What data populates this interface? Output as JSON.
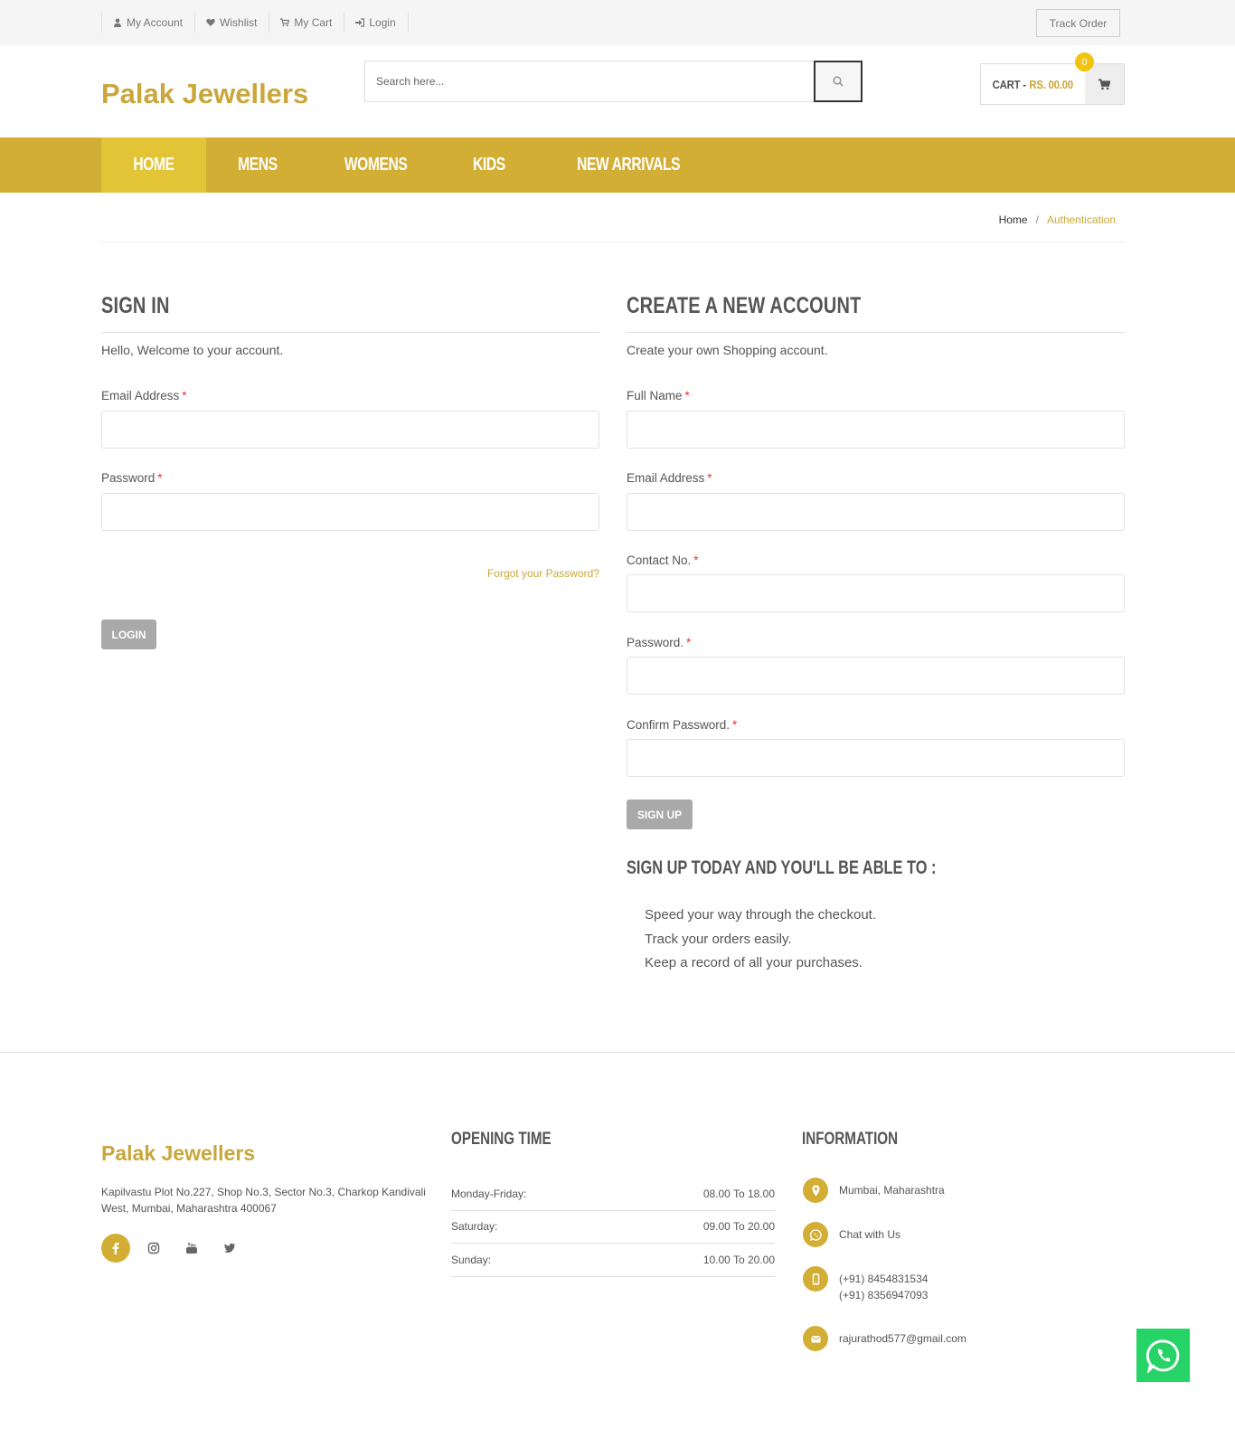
{
  "topbar": {
    "links": [
      {
        "label": "My Account",
        "icon": "user-icon"
      },
      {
        "label": "Wishlist",
        "icon": "heart-icon"
      },
      {
        "label": "My Cart",
        "icon": "cart-icon"
      },
      {
        "label": "Login",
        "icon": "sign-in-icon"
      }
    ],
    "track_order": "Track Order"
  },
  "header": {
    "logo": "Palak Jewellers",
    "search_placeholder": "Search here...",
    "cart_label": "CART -",
    "cart_amount": "RS. 00.00",
    "cart_count": "0"
  },
  "nav": {
    "items": [
      "HOME",
      "MENS",
      "WOMENS",
      "KIDS",
      "NEW ARRIVALS"
    ],
    "active": "HOME"
  },
  "breadcrumb": {
    "home": "Home",
    "separator": "/",
    "current": "Authentication"
  },
  "signin": {
    "title": "SIGN IN",
    "intro": "Hello, Welcome to your account.",
    "email_label": "Email Address",
    "password_label": "Password",
    "required_mark": "*",
    "forgot": "Forgot your Password?",
    "login_button": "LOGIN"
  },
  "signup": {
    "title": "CREATE A NEW ACCOUNT",
    "intro": "Create your own Shopping account.",
    "fullname_label": "Full Name",
    "email_label": "Email Address",
    "contact_label": "Contact No.",
    "password_label": "Password.",
    "confirm_label": "Confirm Password.",
    "signup_button": "SIGN UP",
    "benefits_title": "SIGN UP TODAY AND YOU'LL BE ABLE TO :",
    "benefits": [
      "Speed your way through the checkout.",
      "Track your orders easily.",
      "Keep a record of all your purchases."
    ]
  },
  "footer": {
    "logo": "Palak Jewellers",
    "address": "Kapilvastu Plot No.227, Shop No.3, Sector No.3, Charkop Kandivali West, Mumbai, Maharashtra 400067",
    "socials": [
      "facebook-icon",
      "instagram-icon",
      "youtube-icon",
      "twitter-icon"
    ],
    "opening_title": "OPENING TIME",
    "hours": [
      {
        "day": "Monday-Friday:",
        "time": "08.00 To 18.00"
      },
      {
        "day": "Saturday:",
        "time": "09.00 To 20.00"
      },
      {
        "day": "Sunday:",
        "time": "10.00 To 20.00"
      }
    ],
    "info_title": "INFORMATION",
    "info": {
      "location": "Mumbai, Maharashtra",
      "chat": "Chat with Us",
      "phone1": "(+91) 8454831534",
      "phone2": "(+91) 8356947093",
      "email": "rajurathod577@gmail.com"
    }
  },
  "colors": {
    "brand": "#d3ae34",
    "brand_text": "#c9a73c",
    "whatsapp": "#25d366",
    "button_grey": "#a9a9a9"
  }
}
